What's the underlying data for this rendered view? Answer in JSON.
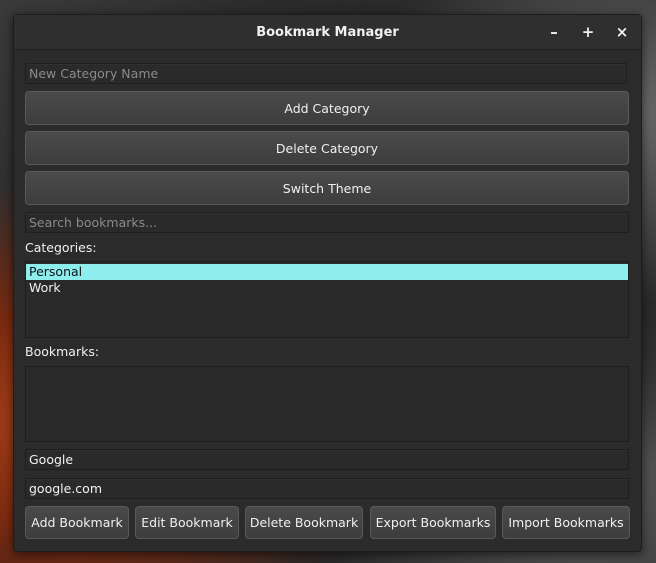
{
  "window": {
    "title": "Bookmark Manager",
    "controls": {
      "minimize": "–",
      "maximize": "+",
      "close": "×"
    }
  },
  "category_input": {
    "value": "",
    "placeholder": "New Category Name"
  },
  "buttons": {
    "add_category": "Add Category",
    "delete_category": "Delete Category",
    "switch_theme": "Switch Theme"
  },
  "search": {
    "value": "",
    "placeholder": "Search bookmarks..."
  },
  "categories": {
    "label": "Categories:",
    "items": [
      {
        "label": "Personal",
        "selected": true
      },
      {
        "label": "Work",
        "selected": false
      }
    ]
  },
  "bookmarks": {
    "label": "Bookmarks:",
    "items": []
  },
  "bookmark_name_input": {
    "value": "Google"
  },
  "bookmark_url_input": {
    "value": "google.com"
  },
  "bottom_buttons": {
    "add": "Add Bookmark",
    "edit": "Edit Bookmark",
    "delete": "Delete Bookmark",
    "export": "Export Bookmarks",
    "import": "Import Bookmarks"
  },
  "colors": {
    "window_bg": "#2b2b2b",
    "selection": "#8eeded",
    "button_bg": "#444444"
  }
}
